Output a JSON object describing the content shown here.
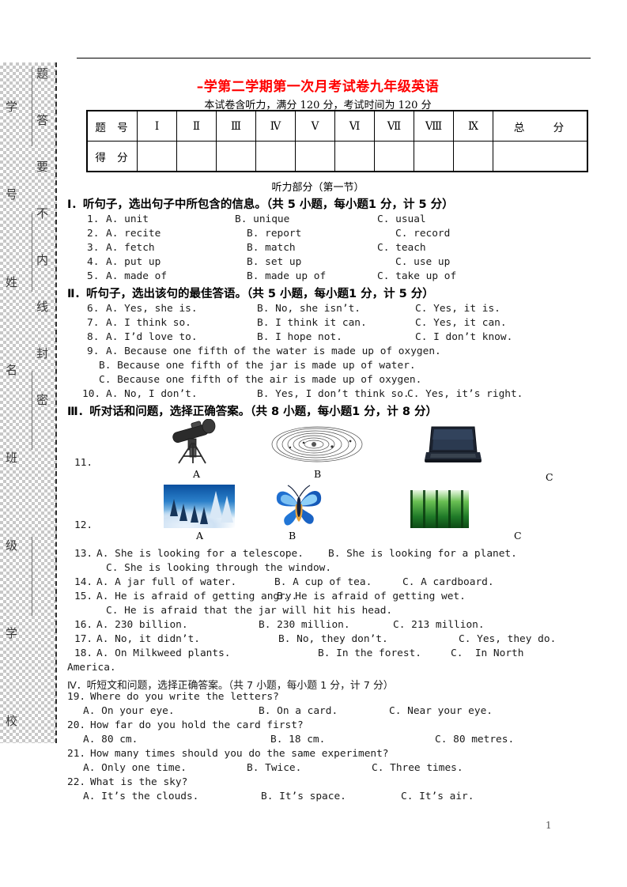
{
  "document": {
    "title": "–学第二学期第一次月考试卷九年级英语",
    "subtitle": "本试卷含听力，满分 120 分，考试时间为 120 分",
    "page_number": "1",
    "title_color": "#ff0000"
  },
  "seal_margin": {
    "right_column_text": "题答要不内线封密",
    "left_column_text": "学号姓名班级学校"
  },
  "score_table": {
    "row_label_1": "题 号",
    "row_label_2": "得 分",
    "columns": [
      "Ⅰ",
      "Ⅱ",
      "Ⅲ",
      "Ⅳ",
      "Ⅴ",
      "Ⅵ",
      "Ⅶ",
      "Ⅷ",
      "Ⅸ"
    ],
    "total_label": "总 分",
    "scores": [
      "",
      "",
      "",
      "",
      "",
      "",
      "",
      "",
      "",
      ""
    ]
  },
  "listening": {
    "part_heading": "听力部分（第一节）",
    "sections": [
      {
        "heading": "Ⅰ．听句子，选出句子中所包含的信息。（共 5 小题，每小题1 分，计 5 分）",
        "items": [
          {
            "num": "1.",
            "a": "A. unit",
            "b": "B. unique",
            "c": "C. usual"
          },
          {
            "num": "2.",
            "a": "A. recite",
            "b": "B. report",
            "c": "C. record"
          },
          {
            "num": "3.",
            "a": "A. fetch",
            "b": "B. match",
            "c": "C. teach"
          },
          {
            "num": "4.",
            "a": "A. put up",
            "b": "B. set up",
            "c": "C. use up"
          },
          {
            "num": "5.",
            "a": "A. made of",
            "b": "B. made up of",
            "c": "C. take up of"
          }
        ]
      },
      {
        "heading": "Ⅱ．听句子，选出该句的最佳答语。（共 5 小题，每小题1 分，计 5 分）",
        "items": [
          {
            "num": "6.",
            "a": "A. Yes, she is.",
            "b": "B. No, she isn’t.",
            "c": "C. Yes, it is."
          },
          {
            "num": "7.",
            "a": "A. I think so.",
            "b": "B. I think it can.",
            "c": "C. Yes, it can."
          },
          {
            "num": "8.",
            "a": "A. I’d love to.",
            "b": "B. I hope not.",
            "c": "C. I don’t know."
          },
          {
            "num": "10.",
            "a": "A. No, I don’t.",
            "b": "B. Yes, I don’t think so.",
            "c": "C. Yes, it’s right."
          }
        ],
        "item9": {
          "num": "9.",
          "a": "A. Because one fifth of the water is made up of oxygen.",
          "b": "B. Because one fifth of the jar is made up of water.",
          "c": "C. Because one fifth of the air is made up of oxygen."
        }
      },
      {
        "heading": "Ⅲ．听对话和问题，选择正确答案。（共 8 小题，每小题1 分，计 8 分）",
        "picture_rows": [
          {
            "num": "11.",
            "options": [
              {
                "label": "A",
                "icon": "telescope-image"
              },
              {
                "label": "B",
                "icon": "solar-system-image"
              },
              {
                "label": "C",
                "icon": "laptop-image"
              }
            ]
          },
          {
            "num": "12.",
            "options": [
              {
                "label": "A",
                "icon": "snow-landscape-image"
              },
              {
                "label": "B",
                "icon": "butterfly-image"
              },
              {
                "label": "C",
                "icon": "forest-image"
              }
            ]
          }
        ],
        "items": [
          {
            "num": "13.",
            "a": "A. She is looking for a telescope.",
            "b": "B. She is looking for a planet.",
            "c": "C. She is looking through the window."
          },
          {
            "num": "14.",
            "a": "A. A jar full of water.",
            "b": "B. A cup of tea.",
            "c": "C. A cardboard."
          },
          {
            "num": "15.",
            "a": "A. He is afraid of getting angry.",
            "b": "B. He is afraid of getting wet.",
            "c": "C. He is afraid that the jar will hit his head."
          },
          {
            "num": "16.",
            "a": "A. 230 billion.",
            "b": "B. 230 million.",
            "c": "C. 213 million."
          },
          {
            "num": "17.",
            "a": "A. No, it didn’t.",
            "b": "B. No, they don’t.",
            "c": "C. Yes, they do."
          },
          {
            "num": "18.",
            "a": "A. On Milkweed plants.",
            "b": "B. In the forest.",
            "c": "C.  In North",
            "c_wrap": "America."
          }
        ]
      },
      {
        "heading": "Ⅳ．听短文和问题，选择正确答案。（共 7 小题，每小题 1 分，计 7 分）",
        "items": [
          {
            "num": "19.",
            "question": "Where do you write the letters?",
            "a": "A. On your eye.",
            "b": "B. On a card.",
            "c": "C. Near your eye."
          },
          {
            "num": "20.",
            "question": "How far do you hold the card first?",
            "a": "A. 80 cm.",
            "b": "B. 18 cm.",
            "c": "C. 80 metres."
          },
          {
            "num": "21.",
            "question": "How many times should you do the same experiment?",
            "a": "A. Only one time.",
            "b": "B. Twice.",
            "c": "C. Three times."
          },
          {
            "num": "22.",
            "question": "What is the sky?",
            "a": "A. It’s the clouds.",
            "b": "B. It’s space.",
            "c": "C. It’s air."
          }
        ]
      }
    ]
  }
}
